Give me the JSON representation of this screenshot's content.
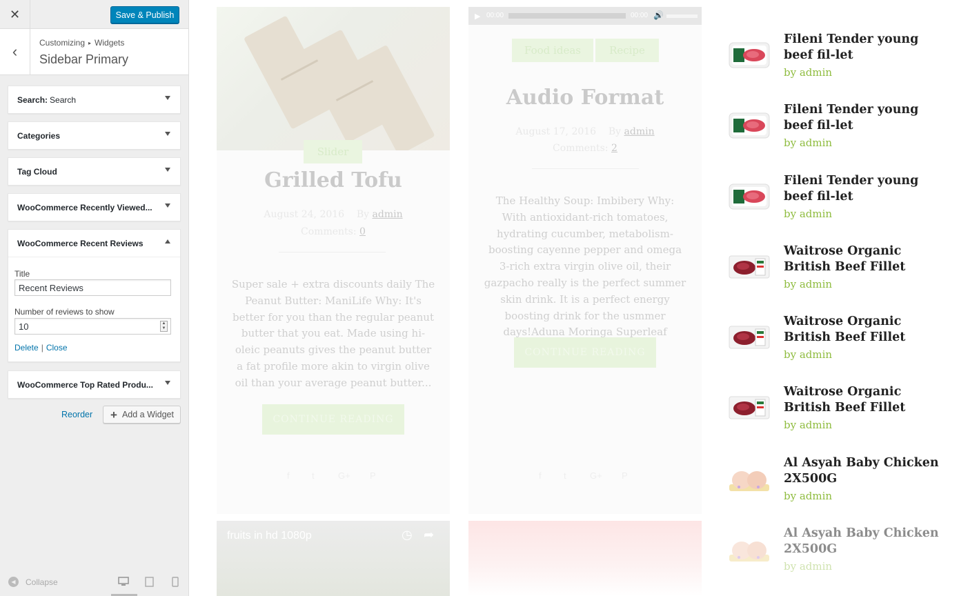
{
  "customizer": {
    "close_icon": "close-icon",
    "publish_label": "Save & Publish",
    "breadcrumb": {
      "root": "Customizing",
      "section": "Widgets"
    },
    "title": "Sidebar Primary",
    "widgets": [
      {
        "name": "Search:",
        "sub": "Search"
      },
      {
        "name": "Categories"
      },
      {
        "name": "Tag Cloud"
      },
      {
        "name": "WooCommerce Recently Viewed..."
      },
      {
        "name": "WooCommerce Recent Reviews",
        "expanded": true
      },
      {
        "name": "WooCommerce Top Rated Produ..."
      }
    ],
    "expanded_form": {
      "title_label": "Title",
      "title_value": "Recent Reviews",
      "count_label": "Number of reviews to show",
      "count_value": "10",
      "delete_label": "Delete",
      "close_label": "Close"
    },
    "reorder_label": "Reorder",
    "add_widget_label": "Add a Widget",
    "collapse_label": "Collapse",
    "devices": [
      "desktop-icon",
      "tablet-icon",
      "mobile-icon"
    ]
  },
  "preview": {
    "post1": {
      "tag": "Slider",
      "title": "Grilled Tofu",
      "date": "August 24, 2016",
      "by": "By",
      "author": "admin",
      "comments_label": "Comments:",
      "comments": "0",
      "excerpt": "Super sale + extra discounts daily The Peanut Butter: ManiLife Why: It's better for you than the regular peanut butter that you eat. Made using hi-oleic peanuts gives the peanut butter a fat profile more akin to virgin olive oil than your average peanut butter...",
      "button": "CONTINUE READING"
    },
    "post2": {
      "audio_time_start": "00:00",
      "audio_time_end": "00:00",
      "tags": [
        "Food ideas",
        "Recipe"
      ],
      "title": "Audio Format",
      "date": "August 17, 2016",
      "by": "By",
      "author": "admin",
      "comments_label": "Comments:",
      "comments": "2",
      "excerpt": "The Healthy Soup: Imbibery Why: With antioxidant-rich tomatoes, hydrating cucumber, metabolism-boosting cayenne pepper and omega 3-rich extra virgin olive oil, their gazpacho really is the perfect summer skin drink. It is a perfect energy boosting drink for the usmmer days!Aduna Moringa Superleaf powder is one...",
      "button": "CONTINUE READING"
    },
    "post3": {
      "video_title": "fruits in hd 1080p"
    },
    "reviews": [
      {
        "title": "Fileni Tender young beef fil-let",
        "author": "by admin",
        "thumb": "beef"
      },
      {
        "title": "Fileni Tender young beef fil-let",
        "author": "by admin",
        "thumb": "beef"
      },
      {
        "title": "Fileni Tender young beef fil-let",
        "author": "by admin",
        "thumb": "beef"
      },
      {
        "title": "Waitrose Organic British Beef Fillet",
        "author": "by admin",
        "thumb": "fillet"
      },
      {
        "title": "Waitrose Organic British Beef Fillet",
        "author": "by admin",
        "thumb": "fillet"
      },
      {
        "title": "Waitrose Organic British Beef Fillet",
        "author": "by admin",
        "thumb": "fillet"
      },
      {
        "title": "Al Asyah Baby Chicken 2X500G",
        "author": "by admin",
        "thumb": "chicken"
      },
      {
        "title": "Al Asyah Baby Chicken 2X500G",
        "author": "by admin",
        "thumb": "chicken"
      }
    ]
  },
  "colors": {
    "primary_button": "#0085ba",
    "link": "#0073aa",
    "author_green": "#8fbc3f"
  }
}
